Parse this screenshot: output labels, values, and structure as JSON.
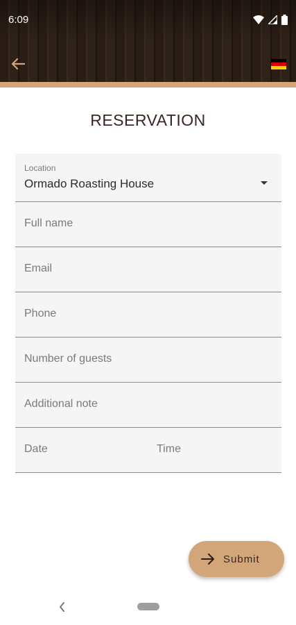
{
  "status_bar": {
    "time": "6:09",
    "icons": [
      "wifi-icon",
      "signal-icon",
      "battery-icon"
    ]
  },
  "app_bar": {
    "back_icon": "arrow-left-icon",
    "language_icon": "german-flag-icon"
  },
  "page": {
    "title": "RESERVATION"
  },
  "form": {
    "location": {
      "label": "Location",
      "value": "Ormado Roasting House"
    },
    "full_name": {
      "placeholder": "Full name"
    },
    "email": {
      "placeholder": "Email"
    },
    "phone": {
      "placeholder": "Phone"
    },
    "guests": {
      "placeholder": "Number of guests"
    },
    "note": {
      "placeholder": "Additional note"
    },
    "date": {
      "placeholder": "Date"
    },
    "time": {
      "placeholder": "Time"
    }
  },
  "submit": {
    "label": "Submit",
    "icon": "arrow-right-icon"
  },
  "colors": {
    "accent": "#d2a679",
    "header_dark": "#2a1d16",
    "title_text": "#3a2620",
    "field_bg": "#f5f5f5"
  }
}
